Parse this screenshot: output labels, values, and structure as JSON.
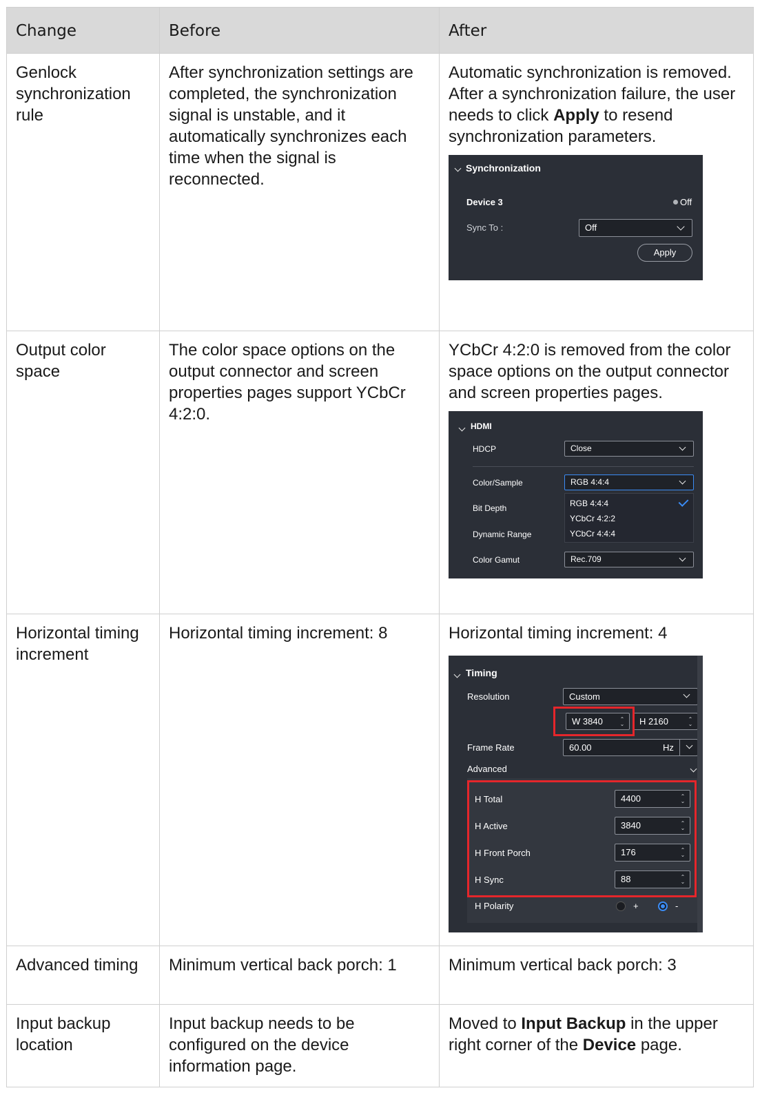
{
  "headers": {
    "change": "Change",
    "before": "Before",
    "after": "After"
  },
  "rows": [
    {
      "change": "Genlock synchronization rule",
      "before": "After synchronization settings are completed, the synchronization signal is unstable, and it automatically synchronizes each time when the signal is reconnected.",
      "after": {
        "pre": "Automatic synchronization is removed. After a synchronization failure, the user needs to click ",
        "bold": "Apply",
        "post": " to resend synchronization parameters."
      }
    },
    {
      "change": "Output color space",
      "before": "The color space options on the output connector and screen properties pages support YCbCr 4:2:0.",
      "after": "YCbCr 4:2:0 is removed from the color space options on the output connector and screen properties pages."
    },
    {
      "change": "Horizontal timing increment",
      "before": "Horizontal timing increment: 8",
      "after": "Horizontal timing increment: 4"
    },
    {
      "change": "Advanced timing",
      "before": "Minimum vertical back porch: 1",
      "after": "Minimum vertical back porch: 3"
    },
    {
      "change": "Input backup location",
      "before": "Input backup needs to be configured on the device information page.",
      "after": {
        "pre": "Moved to ",
        "bold1": "Input Backup",
        "mid": " in the upper right corner of the ",
        "bold2": "Device",
        "post": " page."
      }
    }
  ],
  "sync_panel": {
    "title": "Synchronization",
    "device": "Device 3",
    "status": "Off",
    "sync_to_label": "Sync To :",
    "sync_to_value": "Off",
    "apply": "Apply"
  },
  "hdmi_panel": {
    "title": "HDMI",
    "hdcp_label": "HDCP",
    "hdcp_value": "Close",
    "color_label": "Color/Sample",
    "color_value": "RGB 4:4:4",
    "options": [
      "RGB 4:4:4",
      "YCbCr 4:2:2",
      "YCbCr 4:4:4"
    ],
    "bit_depth_label": "Bit Depth",
    "dynamic_range_label": "Dynamic Range",
    "gamut_label": "Color Gamut",
    "gamut_value": "Rec.709"
  },
  "timing_panel": {
    "title": "Timing",
    "resolution_label": "Resolution",
    "resolution_value": "Custom",
    "width": "W 3840",
    "height": "H  2160",
    "frame_rate_label": "Frame Rate",
    "frame_rate_value": "60.00",
    "frame_rate_unit": "Hz",
    "advanced_label": "Advanced",
    "fields": [
      {
        "label": "H Total",
        "value": "4400"
      },
      {
        "label": "H Active",
        "value": "3840"
      },
      {
        "label": "H Front Porch",
        "value": "176"
      },
      {
        "label": "H Sync",
        "value": "88"
      }
    ],
    "polarity_label": "H Polarity",
    "polarity_plus": "+",
    "polarity_minus": "-",
    "polarity_selected": "-"
  },
  "colors": {
    "header_bg": "#d9d9d9",
    "panel_bg": "#2b2f37",
    "highlight": "#e5262b",
    "accent": "#3b8cf5"
  }
}
